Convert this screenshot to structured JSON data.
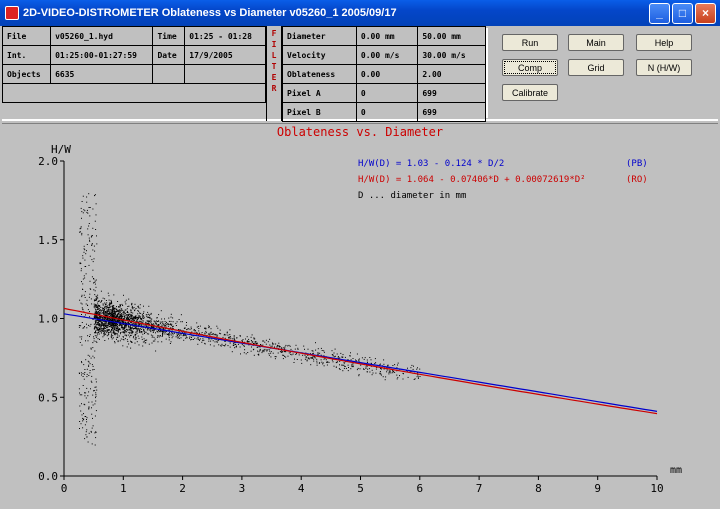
{
  "window": {
    "title": "2D-VIDEO-DISTROMETER  Oblateness vs Diameter   v05260_1   2005/09/17",
    "minimize_glyph": "_",
    "maximize_glyph": "□",
    "close_glyph": "×"
  },
  "info_left": {
    "rows": [
      {
        "label": "File",
        "value": "v05260_1.hyd",
        "label2": "Time",
        "value2": "01:25 - 01:28"
      },
      {
        "label": "Int.",
        "value": "01:25:00-01:27:59",
        "label2": "Date",
        "value2": "17/9/2005"
      },
      {
        "label": "Objects",
        "value": "6635",
        "label2": "",
        "value2": ""
      }
    ]
  },
  "filter_label": "FILTER",
  "info_right": {
    "rows": [
      {
        "label": "Diameter",
        "min": "0.00 mm",
        "max": "50.00 mm"
      },
      {
        "label": "Velocity",
        "min": "0.00 m/s",
        "max": "30.00 m/s"
      },
      {
        "label": "Oblateness",
        "min": "0.00",
        "max": "2.00"
      },
      {
        "label": "Pixel A",
        "min": "0",
        "max": "699"
      },
      {
        "label": "Pixel B",
        "min": "0",
        "max": "699"
      }
    ]
  },
  "buttons": {
    "run": "Run",
    "main": "Main",
    "help": "Help",
    "comp": "Comp",
    "grid": "Grid",
    "nhw": "N (H/W)",
    "calibrate": "Calibrate"
  },
  "chart_data": {
    "type": "scatter",
    "title": "Oblateness vs. Diameter",
    "ylabel": "H/W",
    "xlabel": "mm",
    "xlim": [
      0,
      10
    ],
    "ylim": [
      0,
      2
    ],
    "xticks": [
      "0",
      "1",
      "2",
      "3",
      "4",
      "5",
      "6",
      "7",
      "8",
      "9",
      "10"
    ],
    "yticks": [
      "0.0",
      "0.5",
      "1.0",
      "1.5",
      "2.0"
    ],
    "point_count": 6635,
    "fits": [
      {
        "label": "H/W(D) = 1.03 - 0.124 * D/2",
        "tag": "(PB)",
        "color": "#0000cc",
        "coeffs": [
          1.03,
          -0.062,
          0
        ]
      },
      {
        "label": "H/W(D) = 1.064 - 0.07406*D + 0.00072619*D²",
        "tag": "(RO)",
        "color": "#cc0000",
        "coeffs": [
          1.064,
          -0.07406,
          0.00072619
        ]
      }
    ],
    "note": "D ... diameter in mm",
    "colors": {
      "points": "#000000",
      "title": "#cc0000"
    }
  }
}
